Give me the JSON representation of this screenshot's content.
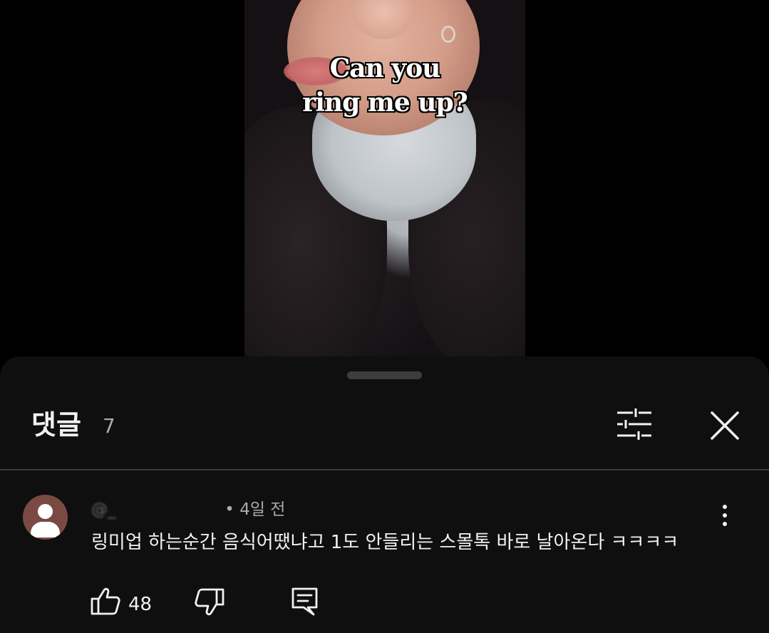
{
  "video": {
    "caption_line1": "Can you",
    "caption_line2": "ring me up?"
  },
  "comments_sheet": {
    "title": "댓글",
    "count": "7",
    "filter_icon": "sort-filter-icon",
    "close_icon": "close-icon"
  },
  "comment": {
    "author": "@⁠_⁠ ⁠ ⁠ ⁠ ⁠ ⁠ ⁠ ⁠ ⁠ ⁠ ⁠ ⁠ ⁠ ⁠ ⁠ ⁠ ⁠ ⁠ ⁠",
    "separator": " • ",
    "time": "4일 전",
    "text": "링미업 하는순간 음식어땠냐고 1도 안들리는 스몰톡 바로 날아온다 ㅋㅋㅋㅋ",
    "likes": "48",
    "avatar_color": "#7a4a42"
  },
  "colors": {
    "background": "#0f0f0f",
    "text_primary": "#f1f1f1",
    "text_secondary": "#aaaaaa",
    "divider": "#3a3a3a"
  }
}
